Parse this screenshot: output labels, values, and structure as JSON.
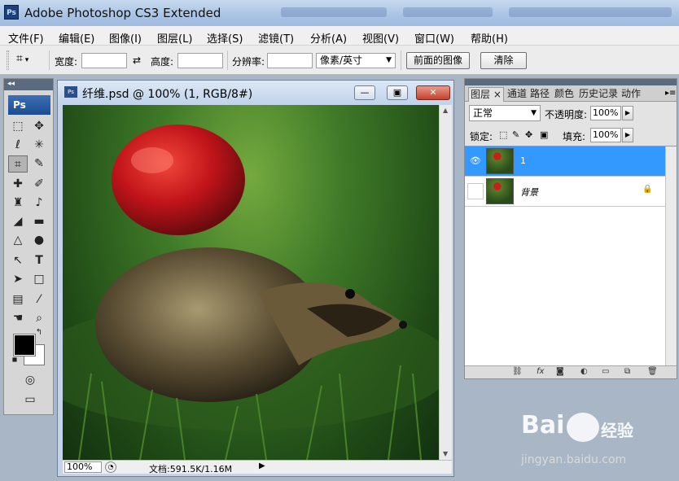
{
  "app": {
    "title": "Adobe Photoshop CS3 Extended",
    "logo": "Ps"
  },
  "menu": [
    "文件(F)",
    "编辑(E)",
    "图像(I)",
    "图层(L)",
    "选择(S)",
    "滤镜(T)",
    "分析(A)",
    "视图(V)",
    "窗口(W)",
    "帮助(H)"
  ],
  "options": {
    "width_label": "宽度:",
    "width_value": "",
    "swap_icon": "⇄",
    "height_label": "高度:",
    "height_value": "",
    "resolution_label": "分辨率:",
    "resolution_value": "",
    "unit": "像素/英寸",
    "front_image": "前面的图像",
    "clear": "清除"
  },
  "toolbox": {
    "logo": "Ps"
  },
  "document": {
    "title": "纤维.psd @ 100% (1, RGB/8#)",
    "zoom": "100%",
    "doc_info": "文档:591.5K/1.16M"
  },
  "layers_panel": {
    "tabs": [
      "图层 ×",
      "通道",
      "路径",
      "颜色",
      "历史记录",
      "动作"
    ],
    "blend_mode": "正常",
    "opacity_label": "不透明度:",
    "opacity": "100%",
    "lock_label": "锁定:",
    "fill_label": "填充:",
    "fill": "100%",
    "layers": [
      {
        "name": "1",
        "visible": true,
        "selected": true
      },
      {
        "name": "背景",
        "visible": false,
        "selected": false,
        "locked": true
      }
    ]
  },
  "watermark": {
    "brand": "Bai",
    "brand2": "经验",
    "url": "jingyan.baidu.com"
  }
}
